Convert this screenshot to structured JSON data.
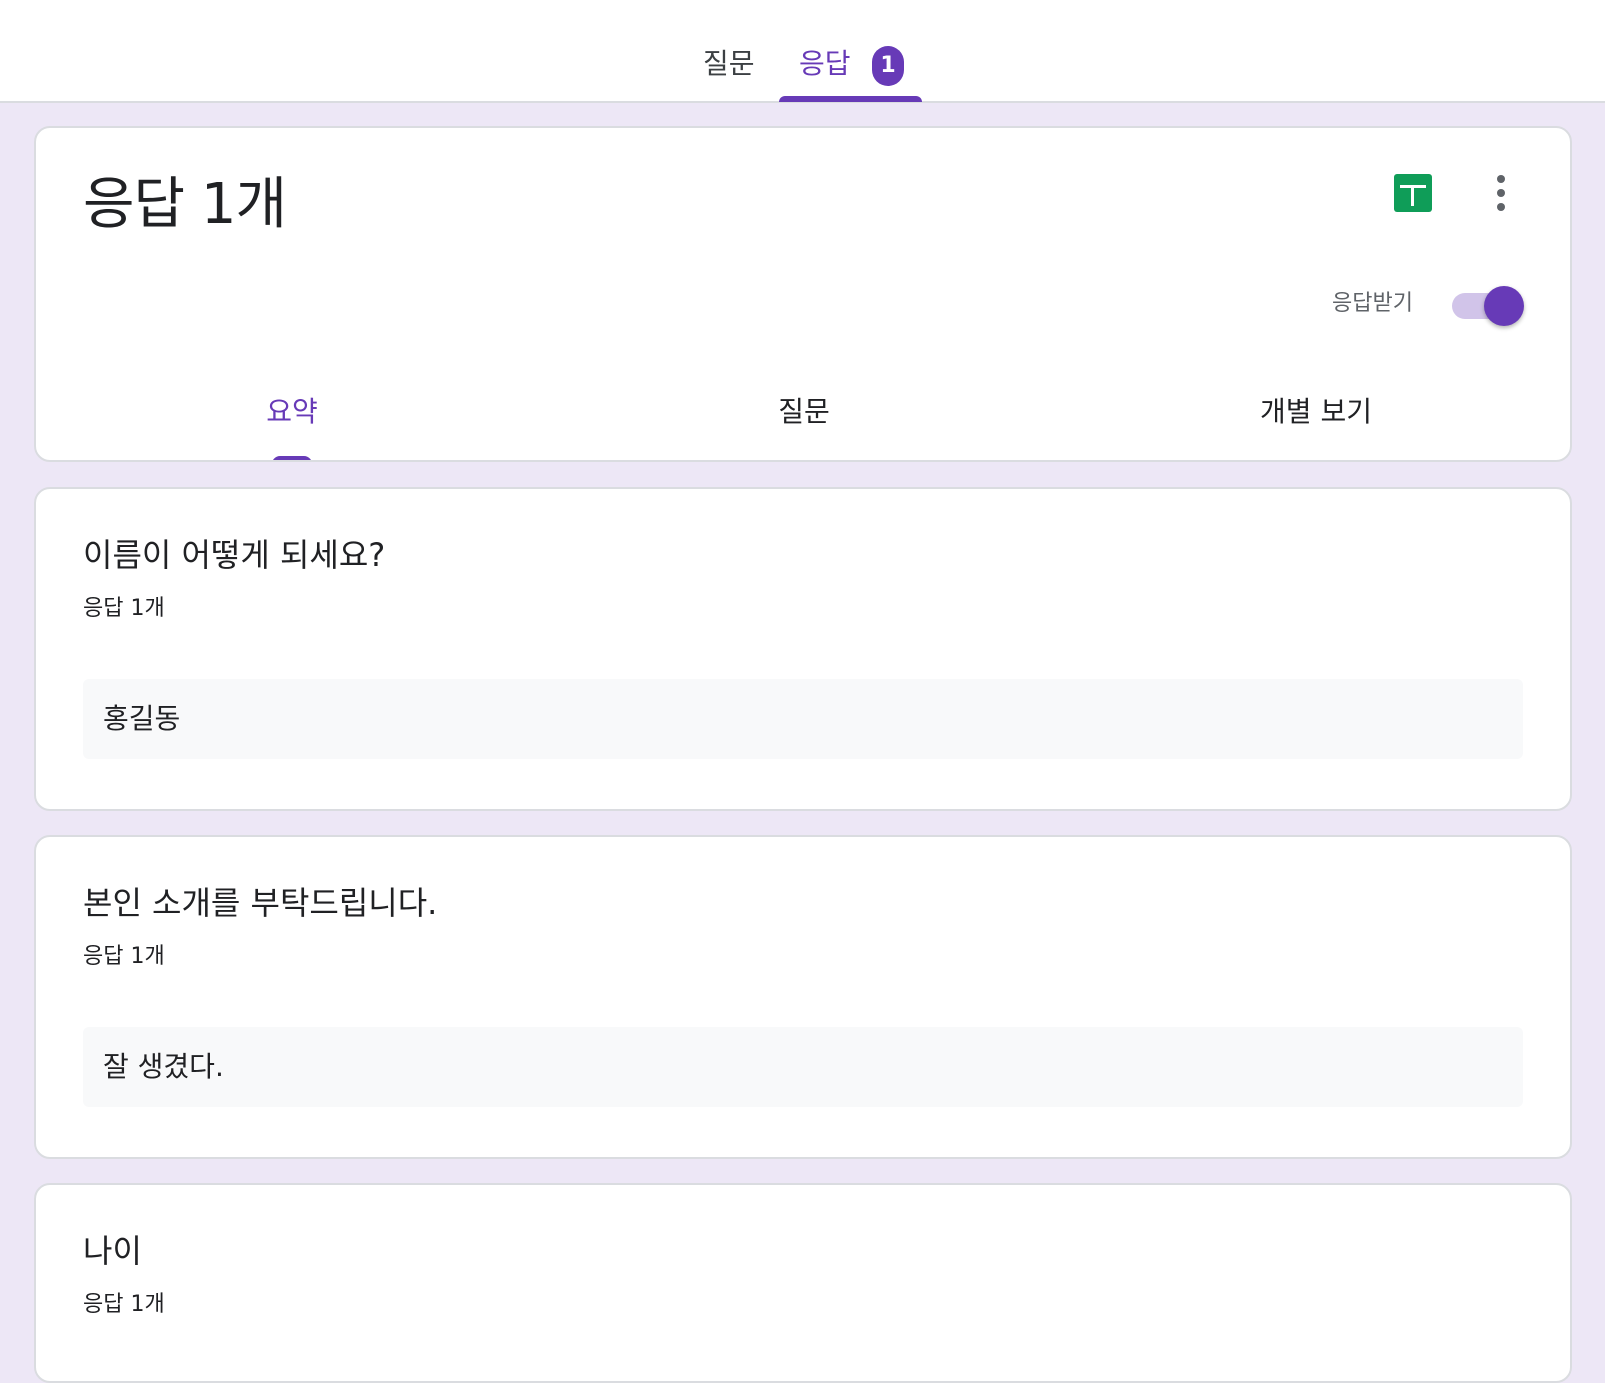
{
  "top_tabs": {
    "questions_label": "질문",
    "responses_label": "응답",
    "responses_badge": "1"
  },
  "header": {
    "title": "응답 1개",
    "accepting_label": "응답받기",
    "accepting_on": true,
    "sheets_icon": "google-sheets-icon",
    "more_icon": "more-vert-icon"
  },
  "sub_tabs": {
    "summary": "요약",
    "question": "질문",
    "individual": "개별 보기"
  },
  "questions": [
    {
      "title": "이름이 어떻게 되세요?",
      "count": "응답 1개",
      "answer": "홍길동"
    },
    {
      "title": "본인 소개를 부탁드립니다.",
      "count": "응답 1개",
      "answer": "잘 생겼다."
    },
    {
      "title": "나이",
      "count": "응답 1개"
    }
  ],
  "colors": {
    "accent": "#673ab7",
    "background": "#ede7f6",
    "sheets_green": "#0f9d58"
  }
}
